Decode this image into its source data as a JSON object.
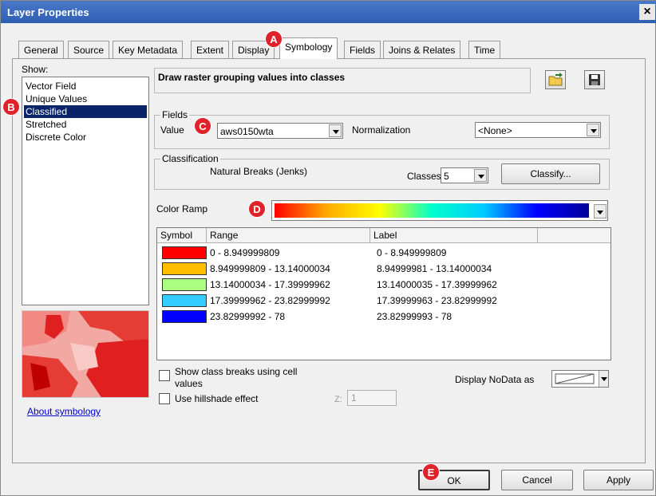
{
  "window": {
    "title": "Layer Properties",
    "close": "×"
  },
  "tabs": [
    "General",
    "Source",
    "Key Metadata",
    "Extent",
    "Display",
    "Symbology",
    "Fields",
    "Joins & Relates",
    "Time"
  ],
  "show": {
    "label": "Show:",
    "items": [
      "Vector Field",
      "Unique Values",
      "Classified",
      "Stretched",
      "Discrete Color"
    ],
    "selected": "Classified"
  },
  "about_link": "About symbology",
  "description": "Draw raster grouping values into classes",
  "fields": {
    "group_label": "Fields",
    "value_label": "Value",
    "value": "aws0150wta",
    "normalization_label": "Normalization",
    "normalization": "<None>"
  },
  "classification": {
    "group_label": "Classification",
    "method": "Natural Breaks (Jenks)",
    "classes_label": "Classes",
    "classes": "5",
    "classify_button": "Classify..."
  },
  "color_ramp": {
    "label": "Color Ramp",
    "colors": [
      "#ff0000",
      "#ffaa00",
      "#ffff00",
      "#00ffcc",
      "#00ccff",
      "#0000ff",
      "#000099"
    ]
  },
  "table": {
    "headers": [
      "Symbol",
      "Range",
      "Label"
    ],
    "rows": [
      {
        "color": "#ff0000",
        "range": "0 - 8.949999809",
        "label": "0 - 8.949999809"
      },
      {
        "color": "#ffbf00",
        "range": "8.949999809 - 13.14000034",
        "label": "8.94999981 - 13.14000034"
      },
      {
        "color": "#aaff80",
        "range": "13.14000034 - 17.39999962",
        "label": "13.14000035 - 17.39999962"
      },
      {
        "color": "#33ccff",
        "range": "17.39999962 - 23.82999992",
        "label": "17.39999963 - 23.82999992"
      },
      {
        "color": "#0000ff",
        "range": "23.82999992 - 78",
        "label": "23.82999993 - 78"
      }
    ]
  },
  "options": {
    "class_breaks_line1": "Show class breaks using cell",
    "class_breaks_line2": "values",
    "hillshade": "Use hillshade effect",
    "z_label": "Z:",
    "z_value": "1",
    "nodata_label": "Display NoData as"
  },
  "buttons": {
    "ok": "OK",
    "cancel": "Cancel",
    "apply": "Apply"
  },
  "annotations": [
    "A",
    "B",
    "C",
    "D",
    "E"
  ]
}
